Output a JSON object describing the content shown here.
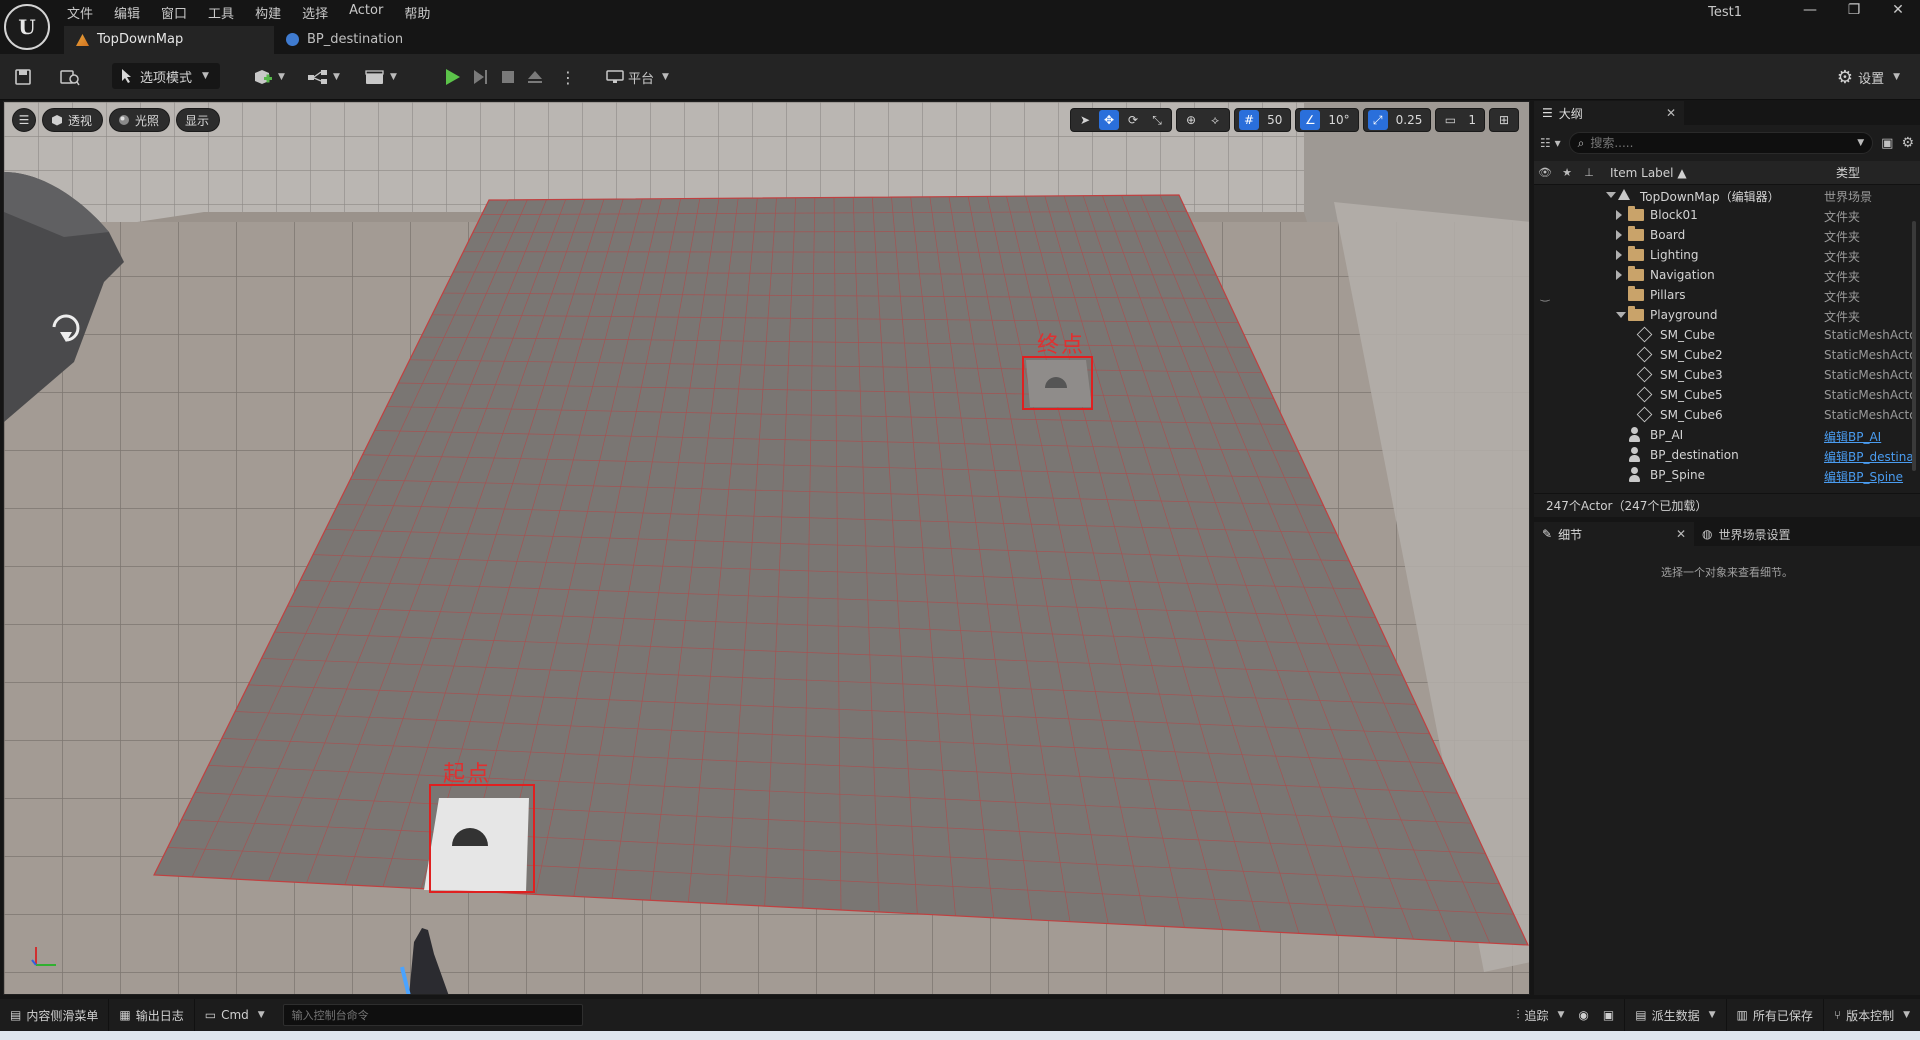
{
  "app": {
    "logo_text": "U",
    "project_name": "Test1",
    "menu": [
      "文件",
      "编辑",
      "窗口",
      "工具",
      "构建",
      "选择",
      "Actor",
      "帮助"
    ],
    "tabs": [
      {
        "label": "TopDownMap",
        "active": true,
        "icon": "map-icon"
      },
      {
        "label": "BP_destination",
        "active": false,
        "icon": "blueprint-icon"
      }
    ],
    "window_controls": {
      "minimize": "—",
      "restore": "❐",
      "close": "✕"
    }
  },
  "toolbar": {
    "mode_label": "选项模式",
    "platform_label": "平台",
    "settings_label": "设置"
  },
  "viewport": {
    "menu_glyph": "☰",
    "perspective_label": "透视",
    "lighting_label": "光照",
    "show_label": "显示",
    "grid_snap": "50",
    "rotation_snap": "10°",
    "scale_snap": "0.25",
    "camera_speed": "1",
    "start_label": "起点",
    "end_label": "终点",
    "colors": {
      "marker": "#e03030",
      "floor": "#7a7673",
      "grid_line": "#c04040",
      "accent": "#2a6fdb"
    }
  },
  "outliner": {
    "title": "大纲",
    "search_placeholder": "搜索.....",
    "col_label": "Item Label ▲",
    "col_type": "类型",
    "rows": [
      {
        "label": "TopDownMap（编辑器）",
        "type": "世界场景",
        "depth": 0,
        "icon": "map-icon",
        "arrow": "expanded"
      },
      {
        "label": "Block01",
        "type": "文件夹",
        "depth": 1,
        "icon": "folder-icon",
        "arrow": "collapsed"
      },
      {
        "label": "Board",
        "type": "文件夹",
        "depth": 1,
        "icon": "folder-icon",
        "arrow": "collapsed"
      },
      {
        "label": "Lighting",
        "type": "文件夹",
        "depth": 1,
        "icon": "folder-icon",
        "arrow": "collapsed"
      },
      {
        "label": "Navigation",
        "type": "文件夹",
        "depth": 1,
        "icon": "folder-icon",
        "arrow": "collapsed"
      },
      {
        "label": "Pillars",
        "type": "文件夹",
        "depth": 1,
        "icon": "folder-icon",
        "arrow": "none"
      },
      {
        "label": "Playground",
        "type": "文件夹",
        "depth": 1,
        "icon": "folder-icon",
        "arrow": "expanded"
      },
      {
        "label": "SM_Cube",
        "type": "StaticMeshActor",
        "depth": 2,
        "icon": "cube-icon",
        "arrow": "none"
      },
      {
        "label": "SM_Cube2",
        "type": "StaticMeshActor",
        "depth": 2,
        "icon": "cube-icon",
        "arrow": "none"
      },
      {
        "label": "SM_Cube3",
        "type": "StaticMeshActor",
        "depth": 2,
        "icon": "cube-icon",
        "arrow": "none"
      },
      {
        "label": "SM_Cube5",
        "type": "StaticMeshActor",
        "depth": 2,
        "icon": "cube-icon",
        "arrow": "none"
      },
      {
        "label": "SM_Cube6",
        "type": "StaticMeshActor",
        "depth": 2,
        "icon": "cube-icon",
        "arrow": "none"
      },
      {
        "label": "BP_AI",
        "type": "编辑BP_AI",
        "depth": 1,
        "icon": "actor-icon",
        "arrow": "none",
        "link": true
      },
      {
        "label": "BP_destination",
        "type": "编辑BP_destination",
        "depth": 1,
        "icon": "actor-icon",
        "arrow": "none",
        "link": true
      },
      {
        "label": "BP_Spine",
        "type": "编辑BP_Spine",
        "depth": 1,
        "icon": "actor-icon",
        "arrow": "none",
        "link": true
      }
    ],
    "footer": "247个Actor（247个已加载）"
  },
  "details": {
    "tab_label": "细节",
    "world_settings_label": "世界场景设置",
    "empty_message": "选择一个对象来查看细节。"
  },
  "statusbar": {
    "content_drawer": "内容侧滑菜单",
    "output_log": "输出日志",
    "cmd": "Cmd",
    "console_placeholder": "输入控制台命令",
    "trace": "追踪",
    "derived_data": "派生数据",
    "all_saved": "所有已保存",
    "source_control": "版本控制"
  }
}
